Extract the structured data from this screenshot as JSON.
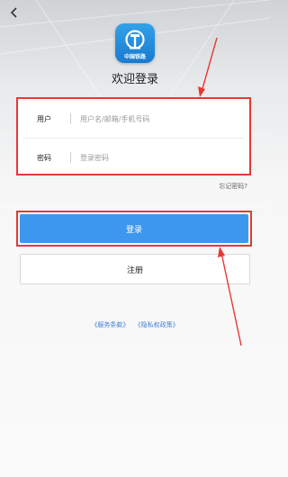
{
  "header": {
    "back_icon": "chevron-left-icon"
  },
  "logo": {
    "caption": "中国铁路",
    "icon": "railway-logo-icon",
    "color": "#1a7ad0"
  },
  "title": "欢迎登录",
  "form": {
    "username": {
      "label": "用户",
      "placeholder": "用户名/邮箱/手机号码",
      "value": ""
    },
    "password": {
      "label": "密码",
      "placeholder": "登录密码",
      "value": ""
    }
  },
  "forgot_label": "忘记密码?",
  "login_label": "登录",
  "register_label": "注册",
  "terms": {
    "service": "《服务条款》",
    "privacy": "《隐私权政策》"
  },
  "colors": {
    "accent": "#3e97ee",
    "annotation": "#e53935",
    "link": "#3e7fd6"
  }
}
